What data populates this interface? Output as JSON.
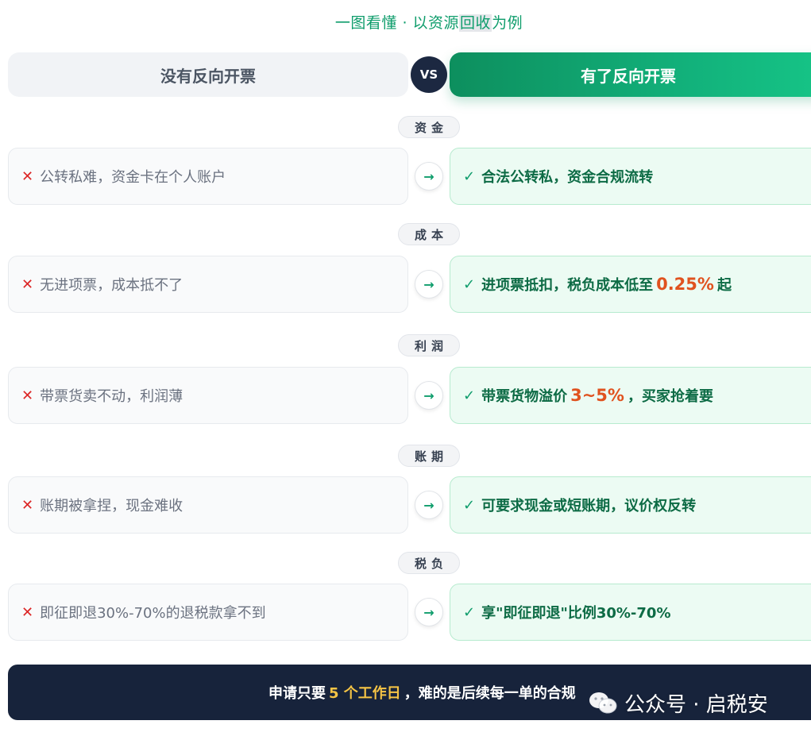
{
  "subtitle_pre": "一图看懂 · 以资源",
  "subtitle_hl": "回收",
  "subtitle_post": "为例",
  "header": {
    "left": "没有反向开票",
    "vs": "VS",
    "right": "有了反向开票"
  },
  "rows": [
    {
      "category": "资金",
      "bad": "公转私难，资金卡在个人账户",
      "good_pre": "合法公转私，资金合规流转",
      "good_num": "",
      "good_post": ""
    },
    {
      "category": "成本",
      "bad": "无进项票，成本抵不了",
      "good_pre": "进项票抵扣，税负成本低至",
      "good_num": "0.25%",
      "good_post": "起"
    },
    {
      "category": "利润",
      "bad": "带票货卖不动，利润薄",
      "good_pre": "带票货物溢价",
      "good_num": "3~5%",
      "good_post": "，买家抢着要"
    },
    {
      "category": "账期",
      "bad": "账期被拿捏，现金难收",
      "good_pre": "可要求现金或短账期，议价权反转",
      "good_num": "",
      "good_post": ""
    },
    {
      "category": "税负",
      "bad": "即征即退30%-70%的退税款拿不到",
      "good_pre": "享\"即征即退\"比例30%-70%",
      "good_num": "",
      "good_post": ""
    }
  ],
  "symbols": {
    "cross": "✕",
    "check": "✓",
    "arrow": "→"
  },
  "footer": {
    "pre": "申请只要",
    "highlight": "5 个工作日",
    "post": "，难的是后续每一单的合规"
  },
  "watermark": "公众号 · 启税安",
  "colors": {
    "brand_green": "#12b07a",
    "navy": "#17233b",
    "accent_orange": "#e0521f",
    "gold": "#f6c445",
    "cross_red": "#dc2626"
  }
}
